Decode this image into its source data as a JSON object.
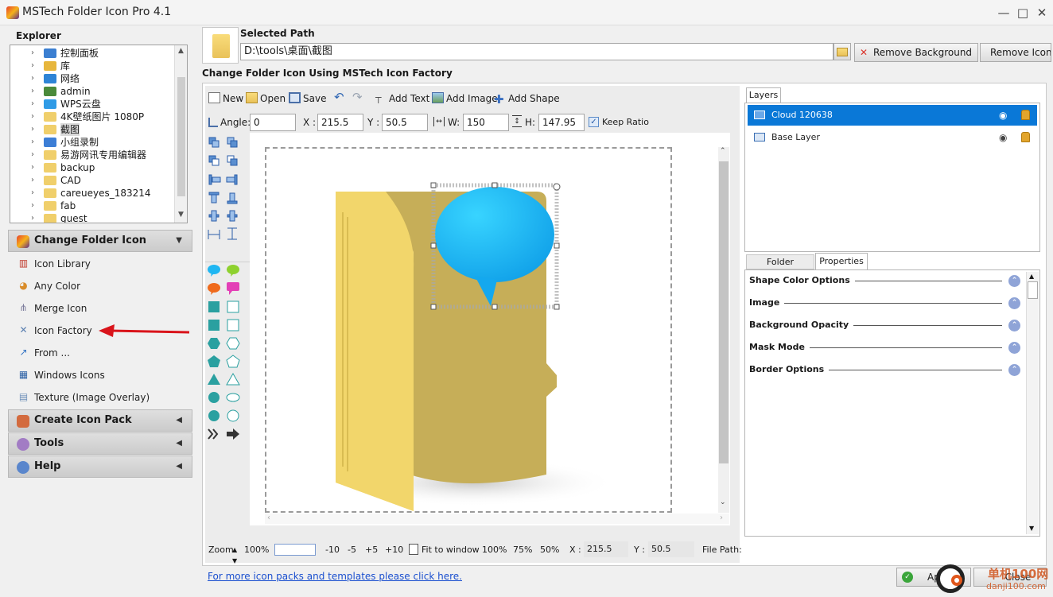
{
  "window": {
    "title": "MSTech Folder Icon Pro 4.1",
    "minimize": "—",
    "maximize": "□",
    "close": "✕"
  },
  "explorer": {
    "title": "Explorer",
    "items": [
      {
        "label": "控制面板",
        "icon": "control-panel-icon",
        "color": "#3b7fd1"
      },
      {
        "label": "库",
        "icon": "library-icon",
        "color": "#e7b63c"
      },
      {
        "label": "网络",
        "icon": "network-icon",
        "color": "#2e84d6"
      },
      {
        "label": "admin",
        "icon": "user-icon",
        "color": "#4a8a3a"
      },
      {
        "label": "WPS云盘",
        "icon": "cloud-drive-icon",
        "color": "#2f9be6"
      },
      {
        "label": "4K壁纸图片 1080P",
        "icon": "folder-icon",
        "color": "#f0cf6b"
      },
      {
        "label": "截图",
        "icon": "folder-icon",
        "color": "#f0cf6b"
      },
      {
        "label": "小组录制",
        "icon": "monitor-icon",
        "color": "#3c7ed6"
      },
      {
        "label": "易游网讯专用编辑器",
        "icon": "folder-icon",
        "color": "#f0cf6b"
      },
      {
        "label": "backup",
        "icon": "folder-icon",
        "color": "#f0cf6b"
      },
      {
        "label": "CAD",
        "icon": "folder-icon",
        "color": "#f0cf6b"
      },
      {
        "label": "careueyes_183214",
        "icon": "folder-icon",
        "color": "#f0cf6b"
      },
      {
        "label": "fab",
        "icon": "folder-icon",
        "color": "#f0cf6b"
      },
      {
        "label": "guest",
        "icon": "folder-icon",
        "color": "#f0cf6b"
      }
    ],
    "selected_index": 6
  },
  "nav": {
    "change_folder_icon": "Change Folder Icon",
    "items": [
      {
        "label": "Icon Library",
        "icon": "bar-chart-icon",
        "glyph": "▥",
        "color": "#c0392b"
      },
      {
        "label": "Any Color",
        "icon": "palette-icon",
        "glyph": "◕",
        "color": "#d98c2a"
      },
      {
        "label": "Merge Icon",
        "icon": "merge-icon",
        "glyph": "⋔",
        "color": "#7a7a9a"
      },
      {
        "label": "Icon Factory",
        "icon": "tools-icon",
        "glyph": "✕",
        "color": "#5a7fb0"
      },
      {
        "label": "From ...",
        "icon": "export-icon",
        "glyph": "↗",
        "color": "#3474c4"
      },
      {
        "label": "Windows Icons",
        "icon": "windows-icon",
        "glyph": "▦",
        "color": "#2f63a6"
      },
      {
        "label": "Texture (Image Overlay)",
        "icon": "texture-icon",
        "glyph": "▤",
        "color": "#6d8fb8"
      }
    ],
    "create_icon_pack": "Create Icon Pack",
    "tools": "Tools",
    "help": "Help"
  },
  "selected_path": {
    "label": "Selected Path",
    "value": "D:\\tools\\桌面\\截图",
    "remove_background": "Remove Background",
    "remove_icon": "Remove Icon"
  },
  "factory": {
    "title": "Change Folder Icon Using MSTech Icon Factory",
    "toolbar": {
      "new": "New",
      "open": "Open",
      "save": "Save",
      "add_text": "Add Text",
      "add_image": "Add Image",
      "add_shape": "Add Shape"
    },
    "transform": {
      "angle_label": "Angle:",
      "angle": "0",
      "x_label": "X :",
      "x": "215.5",
      "y_label": "Y :",
      "y": "50.5",
      "w_label": "W:",
      "w": "150",
      "h_label": "H:",
      "h": "147.95",
      "keep_ratio": "Keep Ratio",
      "keep_ratio_checked": true
    },
    "zoom": {
      "label": "Zoom",
      "value": "100%",
      "minus10": "-10",
      "minus5": "-5",
      "plus5": "+5",
      "plus10": "+10",
      "fit": "Fit to window",
      "z100": "100%",
      "z75": "75%",
      "z50": "50%",
      "x_label": "X :",
      "x": "215.5",
      "y_label": "Y :",
      "y": "50.5",
      "file_path": "File Path:"
    },
    "link": "For more icon packs and templates please click here."
  },
  "layers": {
    "tab": "Layers",
    "items": [
      {
        "name": "Cloud 120638",
        "selected": true
      },
      {
        "name": "Base Layer",
        "selected": false
      }
    ]
  },
  "props": {
    "tab_template": "Folder Template",
    "tab_properties": "Properties",
    "sections": [
      "Shape Color Options",
      "Image",
      "Background Opacity",
      "Mask Mode",
      "Border Options"
    ]
  },
  "footer": {
    "apply": "Apply",
    "close": "Close"
  },
  "watermark": {
    "brand": "单机100网",
    "url": "danji100.com"
  },
  "colors": {
    "selection": "#0a78d7",
    "cloud": "#1fb6f2",
    "folder_front": "#f4dc79",
    "folder_back": "#c9b160",
    "shape_teal": "#2aa0a0",
    "arrow_red": "#d9141b"
  }
}
